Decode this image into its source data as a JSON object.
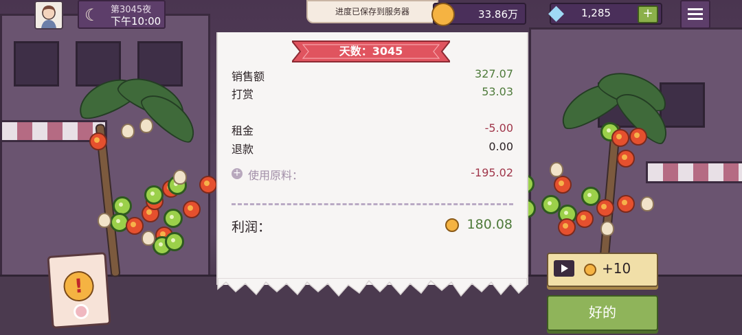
{
  "header": {
    "day_night": "第3045夜",
    "time": "下午10:00",
    "toast": "进度已保存到服务器",
    "coins": "33.86万",
    "gems": "1,285",
    "add_label": "+"
  },
  "receipt": {
    "banner": "天数：3045",
    "sales_label": "销售额",
    "sales_value": "327.07",
    "tips_label": "打赏",
    "tips_value": "53.03",
    "rent_label": "租金",
    "rent_value": "-5.00",
    "refund_label": "退款",
    "refund_value": "0.00",
    "ingredients_label": "使用原料：",
    "ingredients_value": "-195.02",
    "profit_label": "利润：",
    "profit_value": "180.08"
  },
  "buttons": {
    "ad_reward": "+10",
    "ok": "好的"
  },
  "colors": {
    "positive": "#4e7a3a",
    "negative": "#a0364a",
    "banner": "#e0545f",
    "ok_button": "#8fb45a"
  }
}
